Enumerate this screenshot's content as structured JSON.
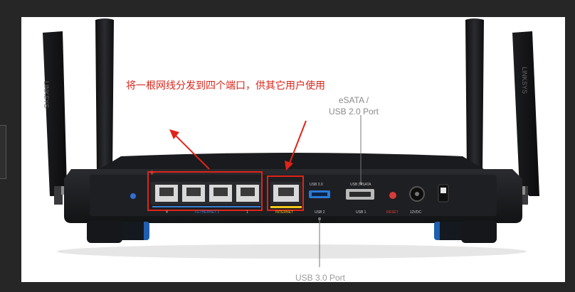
{
  "annotation": {
    "text": "将一根网线分发到四个端口，供其它用户使用",
    "color": "#d9261c",
    "plus_marker": "+"
  },
  "callouts": {
    "esata_line1": "eSATA /",
    "esata_line2": "USB 2.0 Port",
    "usb30_bottom": "USB 3.0 Port"
  },
  "panel_labels": {
    "usb30_top": "USB 3.0",
    "usb_esata_top": "USB | eSATA",
    "port_4": "4",
    "ethernet_mid": "3  ETHERNET  2",
    "port_1": "1",
    "internet": "INTERNET",
    "usb2": "USB 2",
    "usb1": "USB 1",
    "reset": "RESET",
    "power": "12VDC"
  },
  "antenna_brand": "LINKSYS",
  "colors": {
    "highlight_red": "#e0231a",
    "internet_yellow": "#f2c81b",
    "ethernet_blue": "#3b7fd0",
    "router_body": "#1b1c1f"
  }
}
